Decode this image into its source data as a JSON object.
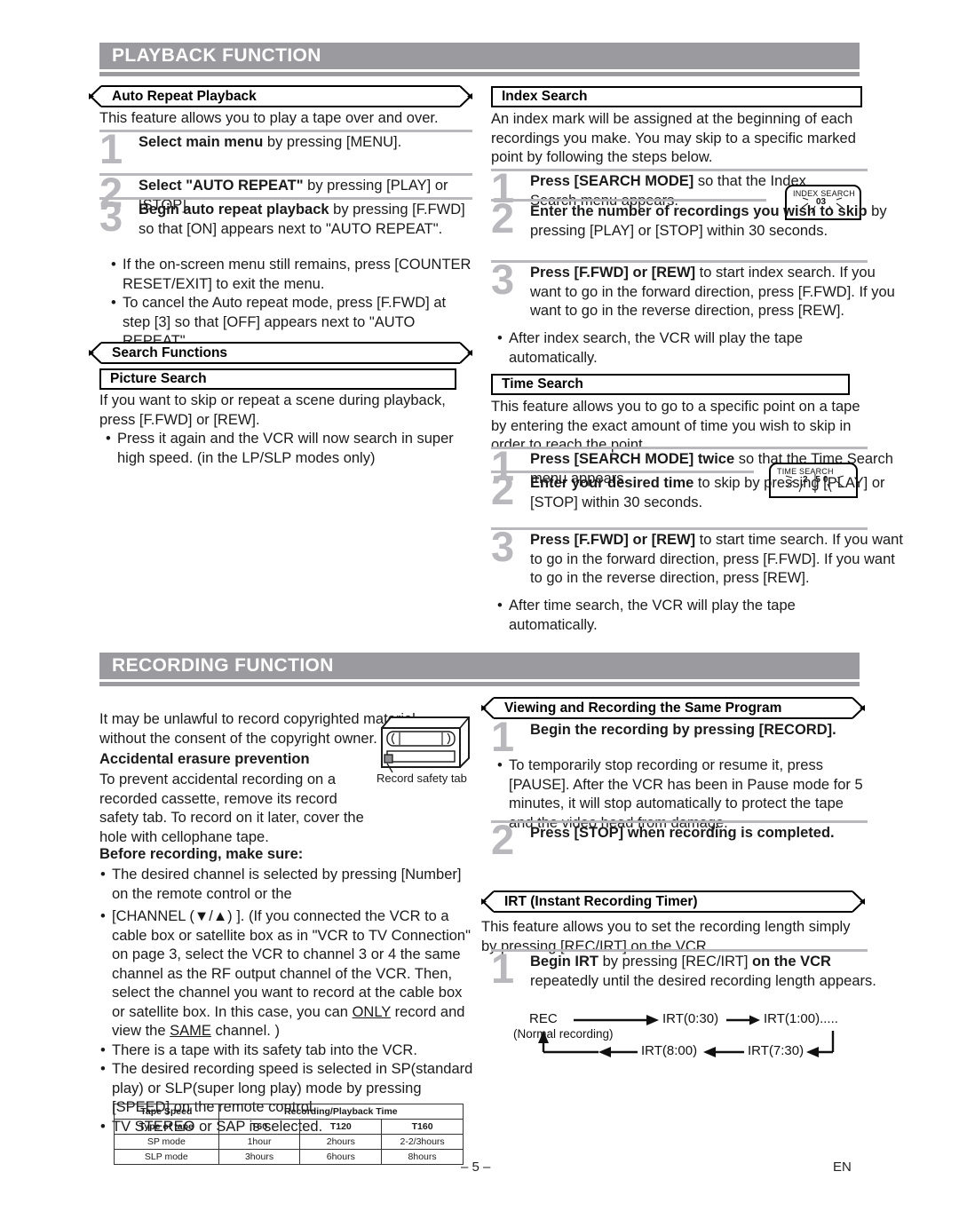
{
  "page": {
    "number": "– 5 –",
    "lang_code": "EN"
  },
  "sections": {
    "playback": {
      "title": "PLAYBACK FUNCTION"
    },
    "recording": {
      "title": "RECORDING FUNCTION"
    }
  },
  "auto_repeat": {
    "heading": "Auto Repeat Playback",
    "intro": "This feature allows you to play a tape over and over.",
    "steps": [
      {
        "num": "1",
        "html": "<b>Select main menu</b> by pressing [MENU]."
      },
      {
        "num": "2",
        "html": "<b>Select \"AUTO REPEAT\"</b> by pressing [PLAY] or [STOP]."
      },
      {
        "num": "3",
        "html": "<b>Begin auto repeat playback</b> by pressing [F.FWD] so that [ON] appears next to \"AUTO REPEAT\"."
      }
    ],
    "bullets": [
      "If the on-screen menu still remains, press [COUNTER RESET/EXIT] to exit the menu.",
      "To cancel the Auto repeat mode, press [F.FWD] at step [3] so that [OFF] appears next to \"AUTO REPEAT\"."
    ]
  },
  "search_functions": {
    "heading": "Search Functions"
  },
  "picture_search": {
    "heading": "Picture Search",
    "intro": "If you want to skip or repeat a scene during playback, press [F.FWD] or [REW].",
    "bullets": [
      "Press it again and the VCR will now search in super high speed. (in the LP/SLP modes only)"
    ]
  },
  "index_search": {
    "heading": "Index Search",
    "intro": "An index mark will be assigned at the beginning of each recordings you make.  You may skip to a specific marked point by following the steps below.",
    "steps": [
      {
        "num": "1",
        "html": "<b>Press [SEARCH MODE]</b> so that the Index Search menu appears."
      },
      {
        "num": "2",
        "html": "<b>Enter the number of recordings you wish to skip</b> by pressing [PLAY] or [STOP] within 30 seconds."
      },
      {
        "num": "3",
        "html": "<b>Press [F.FWD] or [REW]</b> to start index search. If you want to go in the forward direction, press [F.FWD]. If you want to go in the reverse direction, press [REW]."
      }
    ],
    "bullets": [
      "After index search, the VCR will play the tape automatically."
    ],
    "osd": {
      "line1": "INDEX SEARCH",
      "line2": "03"
    }
  },
  "time_search": {
    "heading": "Time Search",
    "intro": "This feature allows you to go to a specific point on a tape by entering the exact amount of time you wish to skip in order to reach the point.",
    "steps": [
      {
        "num": "1",
        "html": "<b>Press  [SEARCH MODE] twice</b> so that the Time Search menu appears."
      },
      {
        "num": "2",
        "html": "<b>Enter your desired time</b> to skip by pressing [PLAY] or [STOP] within 30 seconds."
      },
      {
        "num": "3",
        "html": "<b>Press [F.FWD] or [REW]</b> to start time search. If you want to go in the forward direction, press [F.FWD]. If you want to go in the reverse direction, press [REW]."
      }
    ],
    "bullets": [
      "After time search, the VCR will play the tape automatically."
    ],
    "osd": {
      "line1": "TIME SEARCH",
      "line2": "2 50"
    }
  },
  "recording_left": {
    "intro": "It may be unlawful to record copyrighted material without the consent of the copyright owner.",
    "erasure_heading": "Accidental erasure prevention",
    "erasure_text": "To prevent accidental recording on a recorded cassette, remove its record safety tab. To record on it later, cover the hole with cellophane tape.",
    "before_heading": "Before recording, make sure:",
    "bullets_html": [
      "The desired channel is selected by pressing [Number] on the remote control or the",
      "[CHANNEL (▼/▲) ]. (If you connected the VCR to a cable box or satellite box as in \"VCR to TV Connection\" on page 3, select the VCR to channel 3 or 4 the same channel as the RF output channel of the VCR. Then, select the channel you want to record at the cable box or satellite box. In this case, you can <u>ONLY</u> record and view the <u>SAME</u> channel. )",
      "There is a tape with its safety tab into the VCR.",
      "The desired recording speed is selected in SP(standard play) or SLP(super long play) mode by pressing [SPEED] on the remote control.",
      "TV STEREO or SAP is selected."
    ],
    "cassette_caption": "Record safety tab"
  },
  "tape_table": {
    "header_left": "Tape Speed",
    "header_right": "Recording/Playback Time",
    "row_label": "Type of tape",
    "columns": [
      "T60",
      "T120",
      "T160"
    ],
    "rows": [
      {
        "label": "SP   mode",
        "values": [
          "1hour",
          "2hours",
          "2-2/3hours"
        ]
      },
      {
        "label": "SLP mode",
        "values": [
          "3hours",
          "6hours",
          "8hours"
        ]
      }
    ]
  },
  "viewing_recording": {
    "heading": "Viewing and Recording the Same Program",
    "steps": [
      {
        "num": "1",
        "html": "<b>Begin the recording by pressing [RECORD].</b>"
      },
      {
        "num": "2",
        "html": "<b>Press [STOP] when recording is completed.</b>"
      }
    ],
    "bullets": [
      "To temporarily stop recording or resume it, press [PAUSE]. After the VCR has been in Pause mode for 5 minutes, it will stop automatically to protect the tape and the video head from damage."
    ]
  },
  "irt": {
    "heading": "IRT (Instant Recording Timer)",
    "intro": "This feature allows you to set the recording length simply by pressing [REC/IRT] on the VCR.",
    "steps": [
      {
        "num": "1",
        "html": "<b>Begin IRT</b> by pressing [REC/IRT] <b>on the VCR</b> repeatedly until the desired recording length appears."
      }
    ],
    "diagram": {
      "rec": "REC",
      "rec_sub": "(Normal recording)",
      "n1": "IRT(0:30)",
      "n2": "IRT(1:00).....",
      "n3": "IRT(7:30)",
      "n4": "IRT(8:00)"
    }
  }
}
